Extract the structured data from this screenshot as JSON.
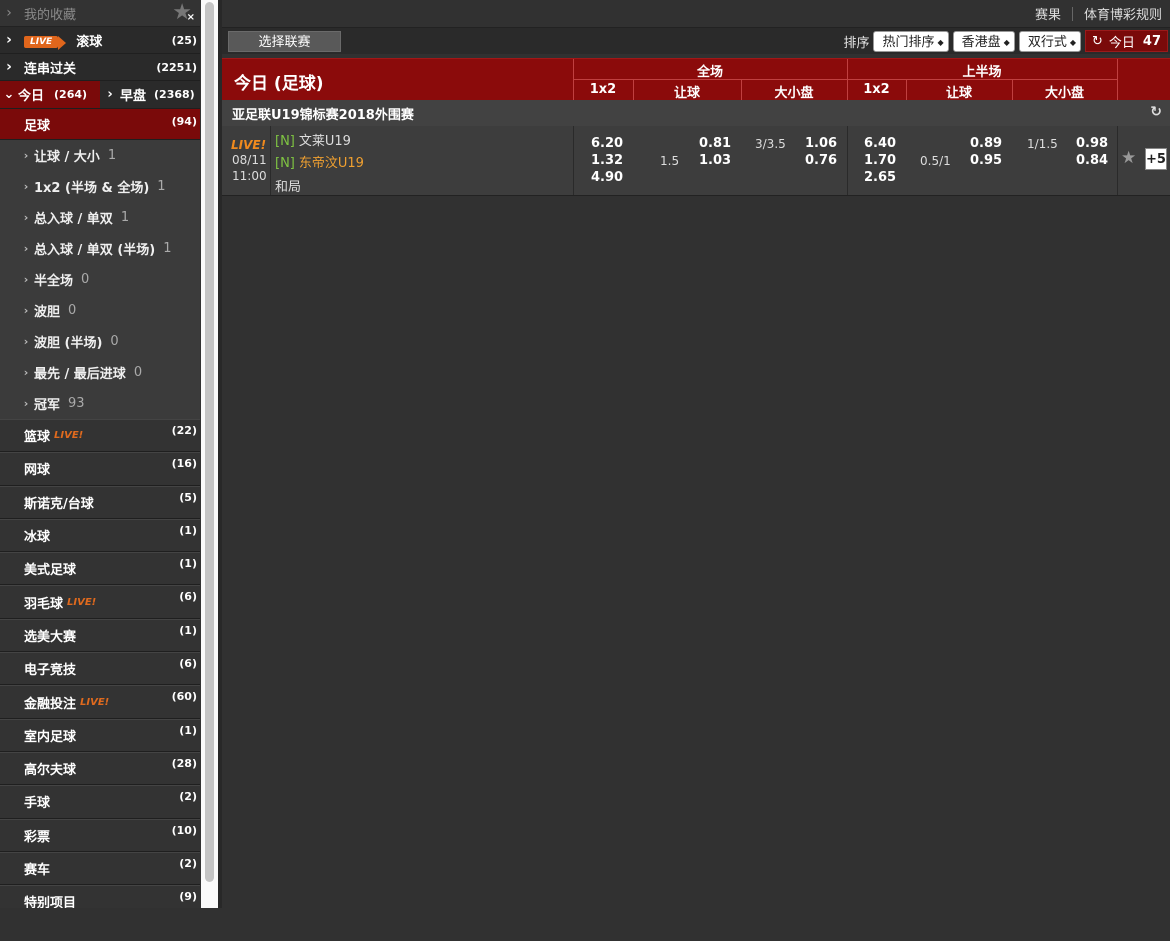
{
  "sidebar": {
    "favorites": {
      "label": "我的收藏"
    },
    "live": {
      "badge": "LIVE",
      "label": "滚球",
      "count": "(25)"
    },
    "parlay": {
      "label": "连串过关",
      "count": "(2251)"
    },
    "today": {
      "label": "今日",
      "count": "(264)"
    },
    "early": {
      "label": "早盘",
      "count": "(2368)"
    },
    "soccer": {
      "label": "足球",
      "count": "(94)"
    },
    "sub_items": [
      {
        "label": "让球 / 大小",
        "count": "1"
      },
      {
        "label": "1x2 (半场 & 全场)",
        "count": "1"
      },
      {
        "label": "总入球 / 单双",
        "count": "1"
      },
      {
        "label": "总入球 / 单双 (半场)",
        "count": "1"
      },
      {
        "label": "半全场",
        "count": "0"
      },
      {
        "label": "波胆",
        "count": "0"
      },
      {
        "label": "波胆 (半场)",
        "count": "0"
      },
      {
        "label": "最先 / 最后进球",
        "count": "0"
      },
      {
        "label": "冠军",
        "count": "93"
      }
    ],
    "sports": [
      {
        "label": "篮球",
        "live": "LIVE!",
        "count": "(22)"
      },
      {
        "label": "网球",
        "live": "",
        "count": "(16)"
      },
      {
        "label": "斯诺克/台球",
        "live": "",
        "count": "(5)"
      },
      {
        "label": "冰球",
        "live": "",
        "count": "(1)"
      },
      {
        "label": "美式足球",
        "live": "",
        "count": "(1)"
      },
      {
        "label": "羽毛球",
        "live": "LIVE!",
        "count": "(6)"
      },
      {
        "label": "选美大赛",
        "live": "",
        "count": "(1)"
      },
      {
        "label": "电子竞技",
        "live": "",
        "count": "(6)"
      },
      {
        "label": "金融投注",
        "live": "LIVE!",
        "count": "(60)"
      },
      {
        "label": "室内足球",
        "live": "",
        "count": "(1)"
      },
      {
        "label": "高尔夫球",
        "live": "",
        "count": "(28)"
      },
      {
        "label": "手球",
        "live": "",
        "count": "(2)"
      },
      {
        "label": "彩票",
        "live": "",
        "count": "(10)"
      },
      {
        "label": "赛车",
        "live": "",
        "count": "(2)"
      },
      {
        "label": "特别项目",
        "live": "",
        "count": "(9)"
      }
    ]
  },
  "topbar": {
    "results": "赛果",
    "rules": "体育博彩规则"
  },
  "toolbar": {
    "select_league": "选择联赛",
    "sort_label": "排序",
    "sort_value": "热门排序",
    "odds_type": "香港盘",
    "view_mode": "双行式",
    "today_label": "今日",
    "today_count": "47"
  },
  "table": {
    "title": "今日 (足球)",
    "full_time": "全场",
    "first_half": "上半场",
    "col_1x2": "1x2",
    "col_handicap": "让球",
    "col_ou": "大小盘"
  },
  "league": {
    "name": "亚足联U19锦标赛2018外围赛"
  },
  "match": {
    "live": "LIVE!",
    "date": "08/11",
    "time": "11:00",
    "neutral_tag": "[N]",
    "home": "文莱U19",
    "away": "东帝汶U19",
    "draw": "和局",
    "ft_1x2": [
      "6.20",
      "1.32",
      "4.90"
    ],
    "ft_hdp_line": "1.5",
    "ft_hdp_odds": [
      "0.81",
      "1.03"
    ],
    "ft_ou_line": "3/3.5",
    "ft_ou_odds": [
      "1.06",
      "0.76"
    ],
    "fh_1x2": [
      "6.40",
      "1.70",
      "2.65"
    ],
    "fh_hdp_line": "0.5/1",
    "fh_hdp_odds": [
      "0.89",
      "0.95"
    ],
    "fh_ou_line": "1/1.5",
    "fh_ou_odds": [
      "0.98",
      "0.84"
    ],
    "more": "+5"
  }
}
